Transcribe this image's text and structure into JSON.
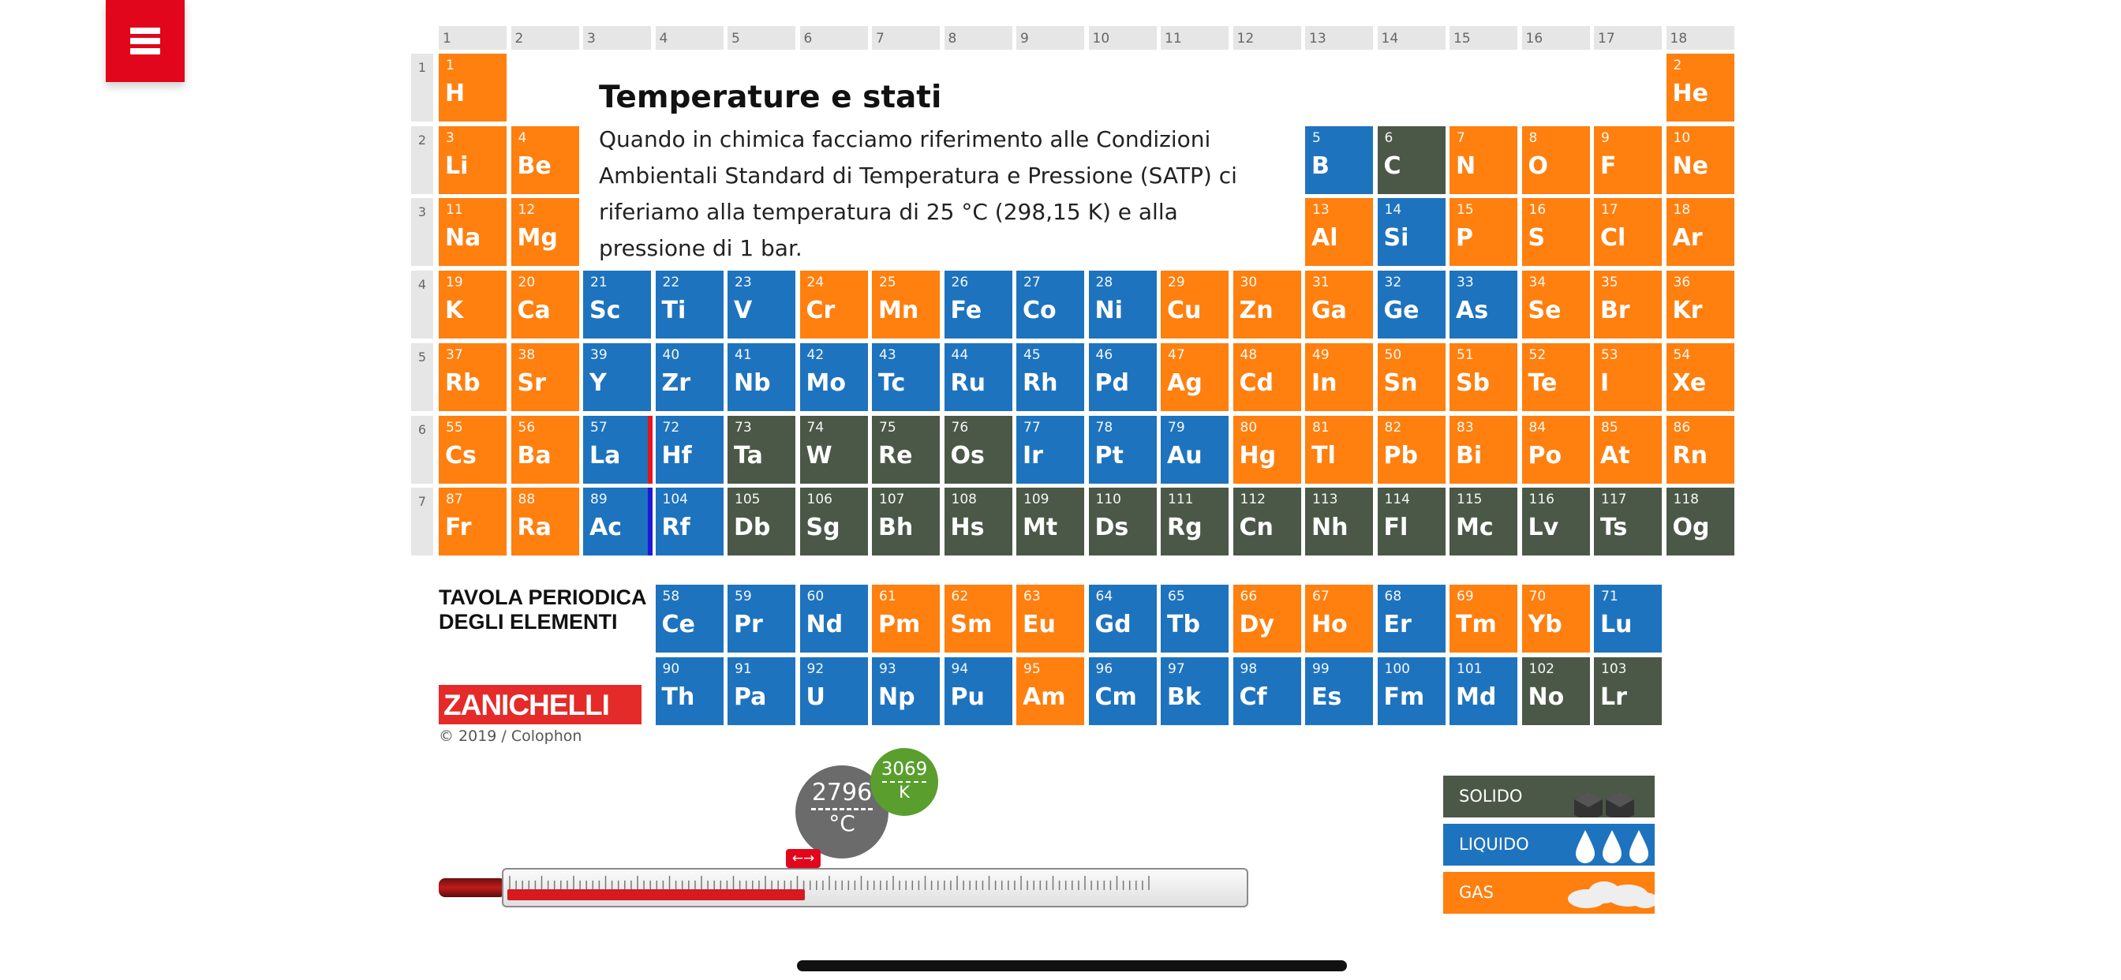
{
  "menu": {
    "icon": "hamburger-menu-icon"
  },
  "colors": {
    "solid": "#4b5847",
    "liquid": "#1e73be",
    "gas": "#ff7f0f",
    "accent": "#e1061b"
  },
  "groups": [
    "1",
    "2",
    "3",
    "4",
    "5",
    "6",
    "7",
    "8",
    "9",
    "10",
    "11",
    "12",
    "13",
    "14",
    "15",
    "16",
    "17",
    "18"
  ],
  "periods": [
    "1",
    "2",
    "3",
    "4",
    "5",
    "6",
    "7"
  ],
  "elements": [
    {
      "n": "1",
      "s": "H",
      "st": "gas"
    },
    {
      "n": "2",
      "s": "He",
      "st": "gas"
    },
    {
      "n": "3",
      "s": "Li",
      "st": "gas"
    },
    {
      "n": "4",
      "s": "Be",
      "st": "gas"
    },
    {
      "n": "5",
      "s": "B",
      "st": "liquid"
    },
    {
      "n": "6",
      "s": "C",
      "st": "solid"
    },
    {
      "n": "7",
      "s": "N",
      "st": "gas"
    },
    {
      "n": "8",
      "s": "O",
      "st": "gas"
    },
    {
      "n": "9",
      "s": "F",
      "st": "gas"
    },
    {
      "n": "10",
      "s": "Ne",
      "st": "gas"
    },
    {
      "n": "11",
      "s": "Na",
      "st": "gas"
    },
    {
      "n": "12",
      "s": "Mg",
      "st": "gas"
    },
    {
      "n": "13",
      "s": "Al",
      "st": "gas"
    },
    {
      "n": "14",
      "s": "Si",
      "st": "liquid"
    },
    {
      "n": "15",
      "s": "P",
      "st": "gas"
    },
    {
      "n": "16",
      "s": "S",
      "st": "gas"
    },
    {
      "n": "17",
      "s": "Cl",
      "st": "gas"
    },
    {
      "n": "18",
      "s": "Ar",
      "st": "gas"
    },
    {
      "n": "19",
      "s": "K",
      "st": "gas"
    },
    {
      "n": "20",
      "s": "Ca",
      "st": "gas"
    },
    {
      "n": "21",
      "s": "Sc",
      "st": "liquid"
    },
    {
      "n": "22",
      "s": "Ti",
      "st": "liquid"
    },
    {
      "n": "23",
      "s": "V",
      "st": "liquid"
    },
    {
      "n": "24",
      "s": "Cr",
      "st": "gas"
    },
    {
      "n": "25",
      "s": "Mn",
      "st": "gas"
    },
    {
      "n": "26",
      "s": "Fe",
      "st": "liquid"
    },
    {
      "n": "27",
      "s": "Co",
      "st": "liquid"
    },
    {
      "n": "28",
      "s": "Ni",
      "st": "liquid"
    },
    {
      "n": "29",
      "s": "Cu",
      "st": "gas"
    },
    {
      "n": "30",
      "s": "Zn",
      "st": "gas"
    },
    {
      "n": "31",
      "s": "Ga",
      "st": "gas"
    },
    {
      "n": "32",
      "s": "Ge",
      "st": "liquid"
    },
    {
      "n": "33",
      "s": "As",
      "st": "liquid"
    },
    {
      "n": "34",
      "s": "Se",
      "st": "gas"
    },
    {
      "n": "35",
      "s": "Br",
      "st": "gas"
    },
    {
      "n": "36",
      "s": "Kr",
      "st": "gas"
    },
    {
      "n": "37",
      "s": "Rb",
      "st": "gas"
    },
    {
      "n": "38",
      "s": "Sr",
      "st": "gas"
    },
    {
      "n": "39",
      "s": "Y",
      "st": "liquid"
    },
    {
      "n": "40",
      "s": "Zr",
      "st": "liquid"
    },
    {
      "n": "41",
      "s": "Nb",
      "st": "liquid"
    },
    {
      "n": "42",
      "s": "Mo",
      "st": "liquid"
    },
    {
      "n": "43",
      "s": "Tc",
      "st": "liquid"
    },
    {
      "n": "44",
      "s": "Ru",
      "st": "liquid"
    },
    {
      "n": "45",
      "s": "Rh",
      "st": "liquid"
    },
    {
      "n": "46",
      "s": "Pd",
      "st": "liquid"
    },
    {
      "n": "47",
      "s": "Ag",
      "st": "gas"
    },
    {
      "n": "48",
      "s": "Cd",
      "st": "gas"
    },
    {
      "n": "49",
      "s": "In",
      "st": "gas"
    },
    {
      "n": "50",
      "s": "Sn",
      "st": "gas"
    },
    {
      "n": "51",
      "s": "Sb",
      "st": "gas"
    },
    {
      "n": "52",
      "s": "Te",
      "st": "gas"
    },
    {
      "n": "53",
      "s": "I",
      "st": "gas"
    },
    {
      "n": "54",
      "s": "Xe",
      "st": "gas"
    },
    {
      "n": "55",
      "s": "Cs",
      "st": "gas"
    },
    {
      "n": "56",
      "s": "Ba",
      "st": "gas"
    },
    {
      "n": "57",
      "s": "La",
      "st": "liquid",
      "bar": "red"
    },
    {
      "n": "72",
      "s": "Hf",
      "st": "liquid"
    },
    {
      "n": "73",
      "s": "Ta",
      "st": "solid"
    },
    {
      "n": "74",
      "s": "W",
      "st": "solid"
    },
    {
      "n": "75",
      "s": "Re",
      "st": "solid"
    },
    {
      "n": "76",
      "s": "Os",
      "st": "solid"
    },
    {
      "n": "77",
      "s": "Ir",
      "st": "liquid"
    },
    {
      "n": "78",
      "s": "Pt",
      "st": "liquid"
    },
    {
      "n": "79",
      "s": "Au",
      "st": "liquid"
    },
    {
      "n": "80",
      "s": "Hg",
      "st": "gas"
    },
    {
      "n": "81",
      "s": "Tl",
      "st": "gas"
    },
    {
      "n": "82",
      "s": "Pb",
      "st": "gas"
    },
    {
      "n": "83",
      "s": "Bi",
      "st": "gas"
    },
    {
      "n": "84",
      "s": "Po",
      "st": "gas"
    },
    {
      "n": "85",
      "s": "At",
      "st": "gas"
    },
    {
      "n": "86",
      "s": "Rn",
      "st": "gas"
    },
    {
      "n": "87",
      "s": "Fr",
      "st": "gas"
    },
    {
      "n": "88",
      "s": "Ra",
      "st": "gas"
    },
    {
      "n": "89",
      "s": "Ac",
      "st": "liquid",
      "bar": "blue"
    },
    {
      "n": "104",
      "s": "Rf",
      "st": "liquid"
    },
    {
      "n": "105",
      "s": "Db",
      "st": "solid"
    },
    {
      "n": "106",
      "s": "Sg",
      "st": "solid"
    },
    {
      "n": "107",
      "s": "Bh",
      "st": "solid"
    },
    {
      "n": "108",
      "s": "Hs",
      "st": "solid"
    },
    {
      "n": "109",
      "s": "Mt",
      "st": "solid"
    },
    {
      "n": "110",
      "s": "Ds",
      "st": "solid"
    },
    {
      "n": "111",
      "s": "Rg",
      "st": "solid"
    },
    {
      "n": "112",
      "s": "Cn",
      "st": "solid"
    },
    {
      "n": "113",
      "s": "Nh",
      "st": "solid"
    },
    {
      "n": "114",
      "s": "Fl",
      "st": "solid"
    },
    {
      "n": "115",
      "s": "Mc",
      "st": "solid"
    },
    {
      "n": "116",
      "s": "Lv",
      "st": "solid"
    },
    {
      "n": "117",
      "s": "Ts",
      "st": "solid"
    },
    {
      "n": "118",
      "s": "Og",
      "st": "solid"
    },
    {
      "n": "58",
      "s": "Ce",
      "st": "liquid"
    },
    {
      "n": "59",
      "s": "Pr",
      "st": "liquid"
    },
    {
      "n": "60",
      "s": "Nd",
      "st": "liquid"
    },
    {
      "n": "61",
      "s": "Pm",
      "st": "gas"
    },
    {
      "n": "62",
      "s": "Sm",
      "st": "gas"
    },
    {
      "n": "63",
      "s": "Eu",
      "st": "gas"
    },
    {
      "n": "64",
      "s": "Gd",
      "st": "liquid"
    },
    {
      "n": "65",
      "s": "Tb",
      "st": "liquid"
    },
    {
      "n": "66",
      "s": "Dy",
      "st": "gas"
    },
    {
      "n": "67",
      "s": "Ho",
      "st": "gas"
    },
    {
      "n": "68",
      "s": "Er",
      "st": "liquid"
    },
    {
      "n": "69",
      "s": "Tm",
      "st": "gas"
    },
    {
      "n": "70",
      "s": "Yb",
      "st": "gas"
    },
    {
      "n": "71",
      "s": "Lu",
      "st": "liquid"
    },
    {
      "n": "90",
      "s": "Th",
      "st": "liquid"
    },
    {
      "n": "91",
      "s": "Pa",
      "st": "liquid"
    },
    {
      "n": "92",
      "s": "U",
      "st": "liquid"
    },
    {
      "n": "93",
      "s": "Np",
      "st": "liquid"
    },
    {
      "n": "94",
      "s": "Pu",
      "st": "liquid"
    },
    {
      "n": "95",
      "s": "Am",
      "st": "gas"
    },
    {
      "n": "96",
      "s": "Cm",
      "st": "liquid"
    },
    {
      "n": "97",
      "s": "Bk",
      "st": "liquid"
    },
    {
      "n": "98",
      "s": "Cf",
      "st": "liquid"
    },
    {
      "n": "99",
      "s": "Es",
      "st": "liquid"
    },
    {
      "n": "100",
      "s": "Fm",
      "st": "liquid"
    },
    {
      "n": "101",
      "s": "Md",
      "st": "liquid"
    },
    {
      "n": "102",
      "s": "No",
      "st": "solid"
    },
    {
      "n": "103",
      "s": "Lr",
      "st": "solid"
    }
  ],
  "info": {
    "title": "Temperature e stati",
    "body": "Quando in chimica facciamo riferimento alle Condizioni Ambientali Standard di Temperatura e Pressione (SATP) ci riferiamo alla temperatura di 25 °C (298,15 K) e alla pressione di 1 bar."
  },
  "brand": {
    "title_line1": "TAVOLA PERIODICA",
    "title_line2": "DEGLI ELEMENTI",
    "logo": "ZANICHELLI",
    "copyright": "© 2019 / Colophon"
  },
  "thermometer": {
    "celsius_value": "2796",
    "celsius_unit": "°C",
    "kelvin_value": "3069",
    "kelvin_unit": "K",
    "handle_label": "←→",
    "level_fraction": 0.46
  },
  "legend": [
    {
      "label": "SOLIDO",
      "state": "solid",
      "icon": "cube-icon"
    },
    {
      "label": "LIQUIDO",
      "state": "liquid",
      "icon": "droplet-icon"
    },
    {
      "label": "GAS",
      "state": "gas",
      "icon": "cloud-icon"
    }
  ]
}
